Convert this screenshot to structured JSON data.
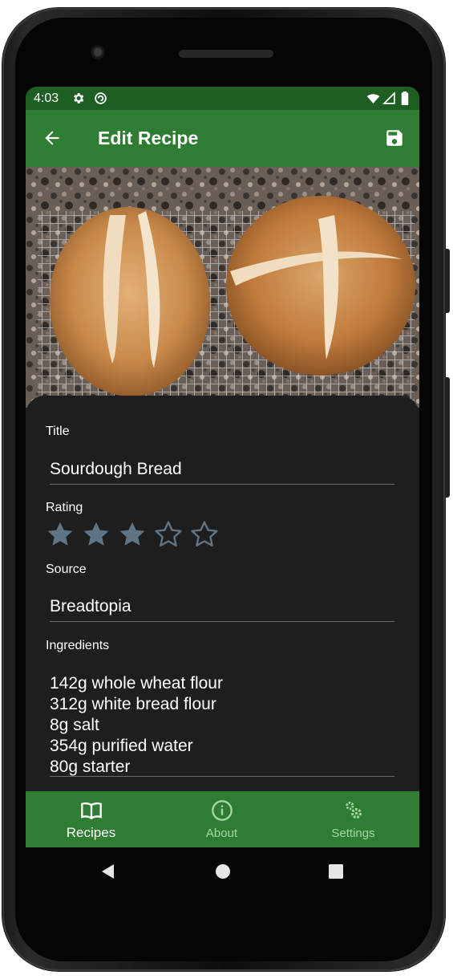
{
  "status_bar": {
    "time": "4:03",
    "icons": [
      "gear-icon",
      "sync-icon",
      "wifi-icon",
      "signal-icon",
      "battery-icon"
    ]
  },
  "app_bar": {
    "title": "Edit Recipe",
    "back_icon": "arrow-back-icon",
    "save_icon": "save-icon"
  },
  "photo": {
    "description_icon": "recipe-photo"
  },
  "form": {
    "title_label": "Title",
    "title_value": "Sourdough Bread",
    "rating_label": "Rating",
    "rating": 3,
    "rating_max": 5,
    "source_label": "Source",
    "source_value": "Breadtopia",
    "ingredients_label": "Ingredients",
    "ingredients": [
      "142g whole wheat flour",
      "312g white bread flour",
      "8g salt",
      "354g purified water",
      "80g starter"
    ]
  },
  "bottom_nav": {
    "items": [
      {
        "label": "Recipes",
        "icon": "book-icon",
        "active": true
      },
      {
        "label": "About",
        "icon": "info-icon",
        "active": false
      },
      {
        "label": "Settings",
        "icon": "gears-icon",
        "active": false
      }
    ]
  },
  "colors": {
    "primary": "#2e7d32",
    "status_bar": "#1e5e22",
    "surface": "#1e1e1e",
    "star": "#5f7485",
    "inactive_nav": "#a5d6a7"
  }
}
